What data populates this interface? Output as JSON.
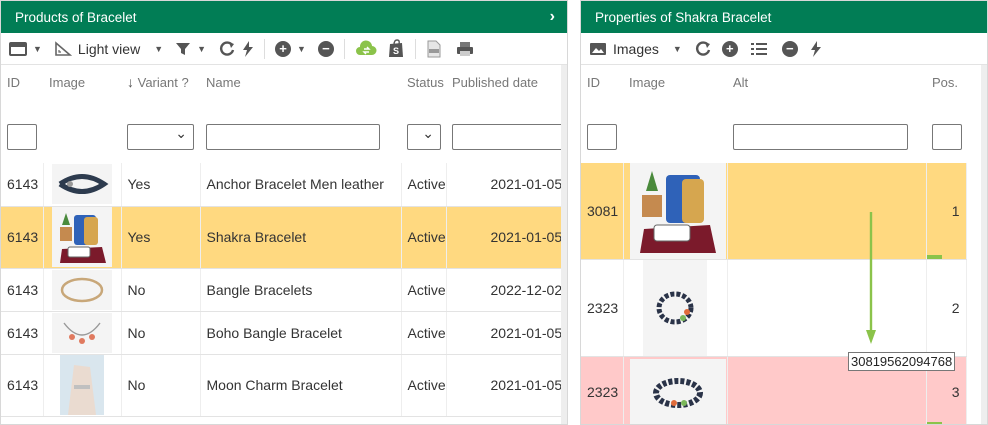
{
  "left": {
    "title": "Products of Bracelet",
    "toolbar": {
      "view_label": "Light view"
    },
    "columns": {
      "id": "ID",
      "image": "Image",
      "variant": "Variant ?",
      "name": "Name",
      "status": "Status",
      "published": "Published date"
    },
    "rows": [
      {
        "id": "6143",
        "variant": "Yes",
        "name": "Anchor Bracelet Men leather",
        "status": "Active",
        "date": "2021-01-05",
        "selected": false
      },
      {
        "id": "6143",
        "variant": "Yes",
        "name": "Shakra Bracelet",
        "status": "Active",
        "date": "2021-01-05",
        "selected": true
      },
      {
        "id": "6143",
        "variant": "No",
        "name": "Bangle Bracelets",
        "status": "Active",
        "date": "2022-12-02",
        "selected": false
      },
      {
        "id": "6143",
        "variant": "No",
        "name": "Boho Bangle Bracelet",
        "status": "Active",
        "date": "2021-01-05",
        "selected": false
      },
      {
        "id": "6143",
        "variant": "No",
        "name": "Moon Charm Bracelet",
        "status": "Active",
        "date": "2021-01-05",
        "selected": false
      }
    ]
  },
  "right": {
    "title": "Properties of Shakra Bracelet",
    "toolbar": {
      "view_label": "Images"
    },
    "columns": {
      "id": "ID",
      "image": "Image",
      "alt": "Alt",
      "pos": "Pos."
    },
    "rows": [
      {
        "id": "3081",
        "alt": "",
        "pos": "1",
        "state": "selected"
      },
      {
        "id": "2323",
        "alt": "",
        "pos": "2",
        "state": "normal"
      },
      {
        "id": "2323",
        "alt": "",
        "pos": "3",
        "state": "pink"
      }
    ],
    "drag_tooltip": "30819562094768"
  },
  "colors": {
    "header": "#017d55",
    "selected": "#ffd980",
    "pink": "#ffc9c9",
    "accent": "#8bc34a"
  }
}
